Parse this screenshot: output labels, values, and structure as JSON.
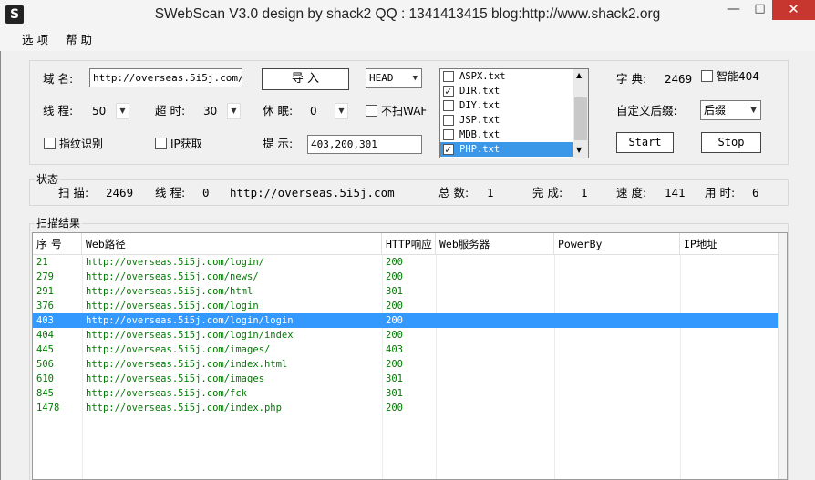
{
  "window": {
    "icon_letter": "S",
    "title": "SWebScan V3.0  design by shack2   QQ : 1341413415  blog:http://www.shack2.org",
    "min_glyph": "—",
    "max_glyph": "□",
    "close_glyph": "✕"
  },
  "menu": [
    "选 项",
    "帮 助"
  ],
  "config": {
    "domain_label": "域 名:",
    "domain_value": "http://overseas.5i5j.com/",
    "import_button": "导 入",
    "method_value": "HEAD",
    "threads_label": "线 程:",
    "threads_value": "50",
    "timeout_label": "超 时:",
    "timeout_value": "30",
    "sleep_label": "休 眠:",
    "sleep_value": "0",
    "no_waf_label": "不扫WAF",
    "fingerprint_label": "指纹识别",
    "ip_label": "IP获取",
    "hint_label": "提 示:",
    "hint_value": "403,200,301",
    "dict_files": [
      {
        "name": "ASPX.txt",
        "checked": false
      },
      {
        "name": "DIR.txt",
        "checked": true
      },
      {
        "name": "DIY.txt",
        "checked": false
      },
      {
        "name": "JSP.txt",
        "checked": false
      },
      {
        "name": "MDB.txt",
        "checked": false
      },
      {
        "name": "PHP.txt",
        "checked": true
      }
    ],
    "dict_label": "字 典:",
    "dict_count": "2469",
    "smart404_label": "智能404",
    "suffix_label": "自定义后缀:",
    "suffix_value": "后缀",
    "start_button": "Start",
    "stop_button": "Stop"
  },
  "status": {
    "title": "状态",
    "scan_label": "扫 描:",
    "scan_value": "2469",
    "threads_label": "线 程:",
    "threads_value": "0",
    "current_url": "http://overseas.5i5j.com",
    "total_label": "总 数:",
    "total_value": "1",
    "done_label": "完 成:",
    "done_value": "1",
    "speed_label": "速 度:",
    "speed_value": "141",
    "time_label": "用 时:",
    "time_value": "6"
  },
  "results": {
    "title": "扫描结果",
    "columns": [
      "序 号",
      "Web路径",
      "HTTP响应",
      "Web服务器",
      "PowerBy",
      "IP地址"
    ],
    "rows": [
      {
        "no": "21",
        "path": "http://overseas.5i5j.com/login/",
        "code": "200"
      },
      {
        "no": "279",
        "path": "http://overseas.5i5j.com/news/",
        "code": "200"
      },
      {
        "no": "291",
        "path": "http://overseas.5i5j.com/html",
        "code": "301"
      },
      {
        "no": "376",
        "path": "http://overseas.5i5j.com/login",
        "code": "200"
      },
      {
        "no": "403",
        "path": "http://overseas.5i5j.com/login/login",
        "code": "200"
      },
      {
        "no": "404",
        "path": "http://overseas.5i5j.com/login/index",
        "code": "200"
      },
      {
        "no": "445",
        "path": "http://overseas.5i5j.com/images/",
        "code": "403"
      },
      {
        "no": "506",
        "path": "http://overseas.5i5j.com/index.html",
        "code": "200"
      },
      {
        "no": "610",
        "path": "http://overseas.5i5j.com/images",
        "code": "301"
      },
      {
        "no": "845",
        "path": "http://overseas.5i5j.com/fck",
        "code": "301"
      },
      {
        "no": "1478",
        "path": "http://overseas.5i5j.com/index.php",
        "code": "200"
      }
    ]
  }
}
